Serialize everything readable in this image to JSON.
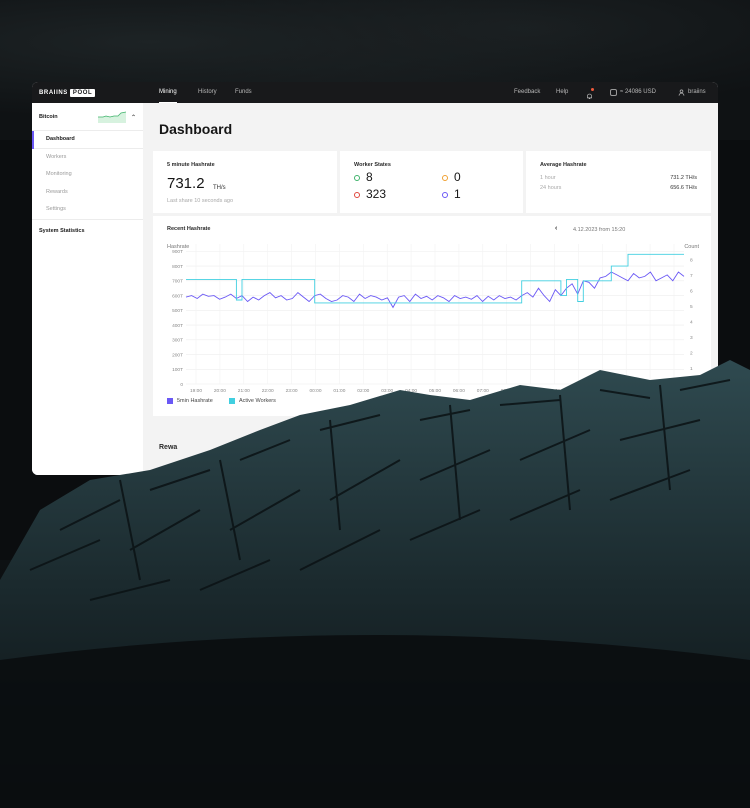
{
  "topbar": {
    "logo_left": "BRAIINS",
    "logo_right": "POOL",
    "tabs": [
      "Mining",
      "History",
      "Funds"
    ],
    "active_tab": "Mining",
    "feedback": "Feedback",
    "help": "Help",
    "balance": "≈ 24086 USD",
    "user": "braiins"
  },
  "sidebar": {
    "coin": "Bitcoin",
    "items": [
      "Dashboard",
      "Workers",
      "Monitoring",
      "Rewards",
      "Settings"
    ],
    "active_item": "Dashboard",
    "system_statistics": "System Statistics"
  },
  "page": {
    "title": "Dashboard"
  },
  "cards": {
    "hashrate": {
      "label": "5 minute Hashrate",
      "value": "731.2",
      "unit": "TH/s",
      "last_share": "Last share 10 seconds ago"
    },
    "worker_states": {
      "label": "Worker States",
      "ok": "8",
      "low": "0",
      "off": "323",
      "dis": "1"
    },
    "average": {
      "label": "Average Hashrate",
      "rows": [
        {
          "period": "1 hour",
          "value": "731.2 TH/s"
        },
        {
          "period": "24 hours",
          "value": "656.6 TH/s"
        }
      ]
    }
  },
  "recent": {
    "label": "Recent Hashrate",
    "date": "4.12.2023 from 15:20",
    "left_axis_label": "Hashrate",
    "right_axis_label": "Count"
  },
  "rewards": {
    "label": "Rewa"
  },
  "colors": {
    "accent": "#6a58f5",
    "hashrate_series": "#6a58f5",
    "workers_series": "#41cfe0",
    "ok": "#3fb36b",
    "low": "#f0a030",
    "off": "#e0463c",
    "dis": "#6a58f5"
  },
  "chart_data": {
    "type": "line",
    "x": [
      "19:00",
      "20:00",
      "21:00",
      "22:00",
      "23:00",
      "00:00",
      "01:00",
      "02:00",
      "03:00",
      "04:00",
      "05:00",
      "06:00",
      "07:00",
      "08:00",
      "09:00",
      "10:00",
      "11:00",
      "12:00",
      "13:00",
      "14:00",
      "15:00"
    ],
    "y_left_ticks": [
      "0",
      "100T",
      "200T",
      "300T",
      "400T",
      "500T",
      "600T",
      "700T",
      "800T",
      "900T"
    ],
    "y_right_ticks": [
      "1",
      "2",
      "3",
      "4",
      "5",
      "6",
      "7",
      "8"
    ],
    "ylim_left": [
      0,
      950
    ],
    "ylim_right": [
      0,
      9
    ],
    "series": [
      {
        "name": "5min Hashrate",
        "axis": "left",
        "values": [
          590,
          600,
          580,
          610,
          595,
          600,
          575,
          590,
          610,
          580,
          600,
          560,
          590,
          570,
          600,
          620,
          585,
          600,
          570,
          580,
          620,
          590,
          560,
          600,
          610,
          580,
          560,
          570,
          600,
          590,
          560,
          610,
          580,
          600,
          590,
          570,
          585,
          520,
          590,
          600,
          560,
          610,
          580,
          595,
          570,
          600,
          585,
          560,
          600,
          580,
          590,
          575,
          600,
          560,
          595,
          570,
          600,
          580,
          590,
          570,
          600,
          620,
          590,
          650,
          600,
          560,
          640,
          600,
          650,
          680,
          610,
          700,
          690,
          650,
          720,
          730,
          760,
          740,
          720,
          700,
          750,
          720,
          730,
          760,
          700,
          720,
          740,
          700,
          760,
          730
        ]
      },
      {
        "name": "Active Workers",
        "axis": "left",
        "values": [
          710,
          710,
          710,
          710,
          710,
          710,
          710,
          710,
          710,
          570,
          710,
          710,
          710,
          710,
          710,
          710,
          710,
          710,
          710,
          710,
          710,
          710,
          710,
          550,
          550,
          550,
          550,
          550,
          550,
          550,
          550,
          550,
          550,
          550,
          550,
          550,
          550,
          550,
          550,
          550,
          550,
          550,
          550,
          550,
          550,
          550,
          550,
          550,
          550,
          550,
          550,
          550,
          550,
          550,
          550,
          550,
          550,
          550,
          550,
          550,
          700,
          700,
          700,
          700,
          700,
          700,
          700,
          600,
          710,
          710,
          560,
          700,
          700,
          700,
          700,
          700,
          800,
          800,
          800,
          880,
          880,
          880,
          880,
          880,
          880,
          880,
          880,
          880,
          880,
          880
        ]
      }
    ],
    "legend": [
      "5min Hashrate",
      "Active Workers"
    ]
  }
}
